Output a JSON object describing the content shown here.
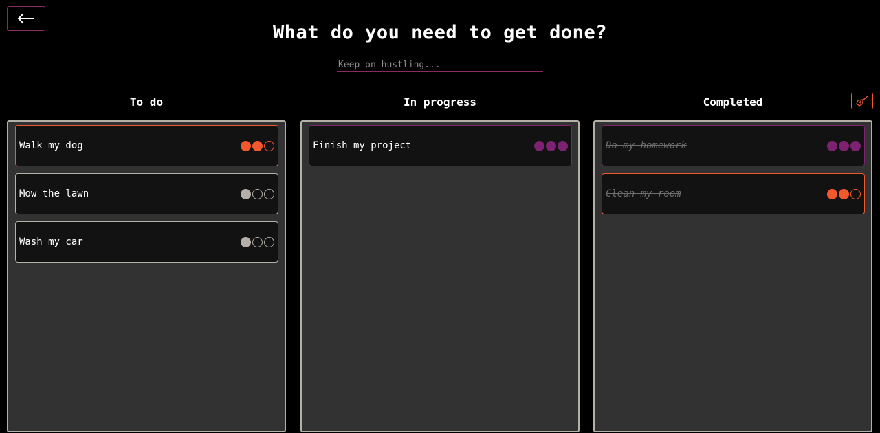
{
  "header": {
    "title": "What do you need to get done?",
    "input_placeholder": "Keep on hustling...",
    "input_value": ""
  },
  "colors": {
    "high": "#f2582e",
    "done_priority": "#7d2270",
    "low": "#b4b0a8",
    "accent_border": "#8a2a63"
  },
  "columns": [
    {
      "title": "To do",
      "cards": [
        {
          "label": "Walk my dog",
          "priority_filled": 2,
          "color": "#f2582e",
          "done": false
        },
        {
          "label": "Mow the lawn",
          "priority_filled": 1,
          "color": "#b4b0a8",
          "done": false
        },
        {
          "label": "Wash my car",
          "priority_filled": 1,
          "color": "#b4b0a8",
          "done": false
        }
      ]
    },
    {
      "title": "In progress",
      "cards": [
        {
          "label": "Finish my project",
          "priority_filled": 3,
          "color": "#7d2270",
          "done": false
        }
      ]
    },
    {
      "title": "Completed",
      "cards": [
        {
          "label": "Do my homework",
          "priority_filled": 3,
          "color": "#7d2270",
          "done": true
        },
        {
          "label": "Clean my room",
          "priority_filled": 2,
          "color": "#f2582e",
          "done": true
        }
      ]
    }
  ]
}
